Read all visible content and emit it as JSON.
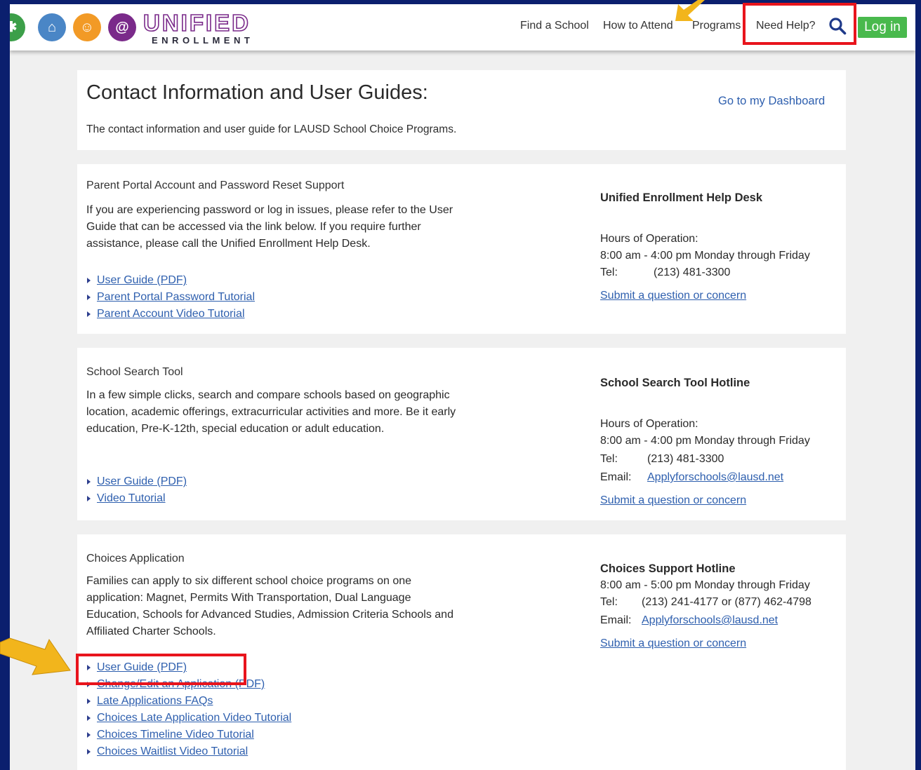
{
  "header": {
    "logo_top": "UNIFIED",
    "logo_bottom": "ENROLLMENT",
    "nav": [
      "Find a School",
      "How to Attend",
      "Programs",
      "Need Help?"
    ],
    "login_label": "Log in"
  },
  "intro": {
    "title": "Contact Information and User Guides:",
    "subtitle": "The contact information and user guide for LAUSD School Choice Programs.",
    "dashboard_link": "Go to my Dashboard"
  },
  "sections": [
    {
      "title": "Parent Portal Account and Password Reset Support",
      "description": "If you are experiencing password or log in issues, please refer to the User Guide that can be accessed via the link below. If you require further assistance, please call the Unified Enrollment Help Desk.",
      "links": [
        "User Guide (PDF)",
        "Parent Portal Password Tutorial",
        "Parent Account Video Tutorial"
      ],
      "contact": {
        "heading": "Unified Enrollment Help Desk",
        "hours_label": "Hours of Operation:",
        "hours": "8:00 am - 4:00 pm Monday through Friday",
        "tel_label": "Tel:",
        "tel": "(213) 481-3300",
        "submit": "Submit a question or concern"
      }
    },
    {
      "title": "School Search Tool",
      "description": "In a few simple clicks, search and compare schools based on geographic location, academic offerings, extracurricular activities and more. Be it early education, Pre-K-12th, special education or adult education.",
      "links": [
        "User Guide (PDF)",
        "Video Tutorial"
      ],
      "contact": {
        "heading": "School Search Tool Hotline",
        "hours_label": "Hours of Operation:",
        "hours": "8:00 am - 4:00 pm Monday through Friday",
        "tel_label": "Tel:",
        "tel": "(213) 481-3300",
        "email_label": "Email:",
        "email": "Applyforschools@lausd.net",
        "submit": "Submit a question or concern"
      }
    },
    {
      "title": "Choices Application",
      "description": "Families can apply to six different school choice programs on one application: Magnet, Permits With Transportation, Dual Language Education, Schools for Advanced Studies, Admission Criteria Schools and Affiliated Charter Schools.",
      "links": [
        "User Guide (PDF)",
        "Change/Edit an Application (PDF)",
        "Late Applications FAQs",
        "Choices Late Application Video Tutorial",
        "Choices Timeline Video Tutorial",
        "Choices Waitlist Video Tutorial"
      ],
      "contact": {
        "heading": "Choices Support Hotline",
        "hours": "8:00 am - 5:00 pm Monday through Friday",
        "tel_label": "Tel:",
        "tel": "(213) 241-4177 or (877) 462-4798",
        "email_label": "Email:",
        "email": "Applyforschools@lausd.net",
        "submit": "Submit a question or concern"
      }
    }
  ],
  "colors": {
    "frame": "#0b1f6e",
    "link": "#2e5fae",
    "login": "#49b94d",
    "highlight": "#e8141c",
    "arrow": "#f2b51c"
  }
}
